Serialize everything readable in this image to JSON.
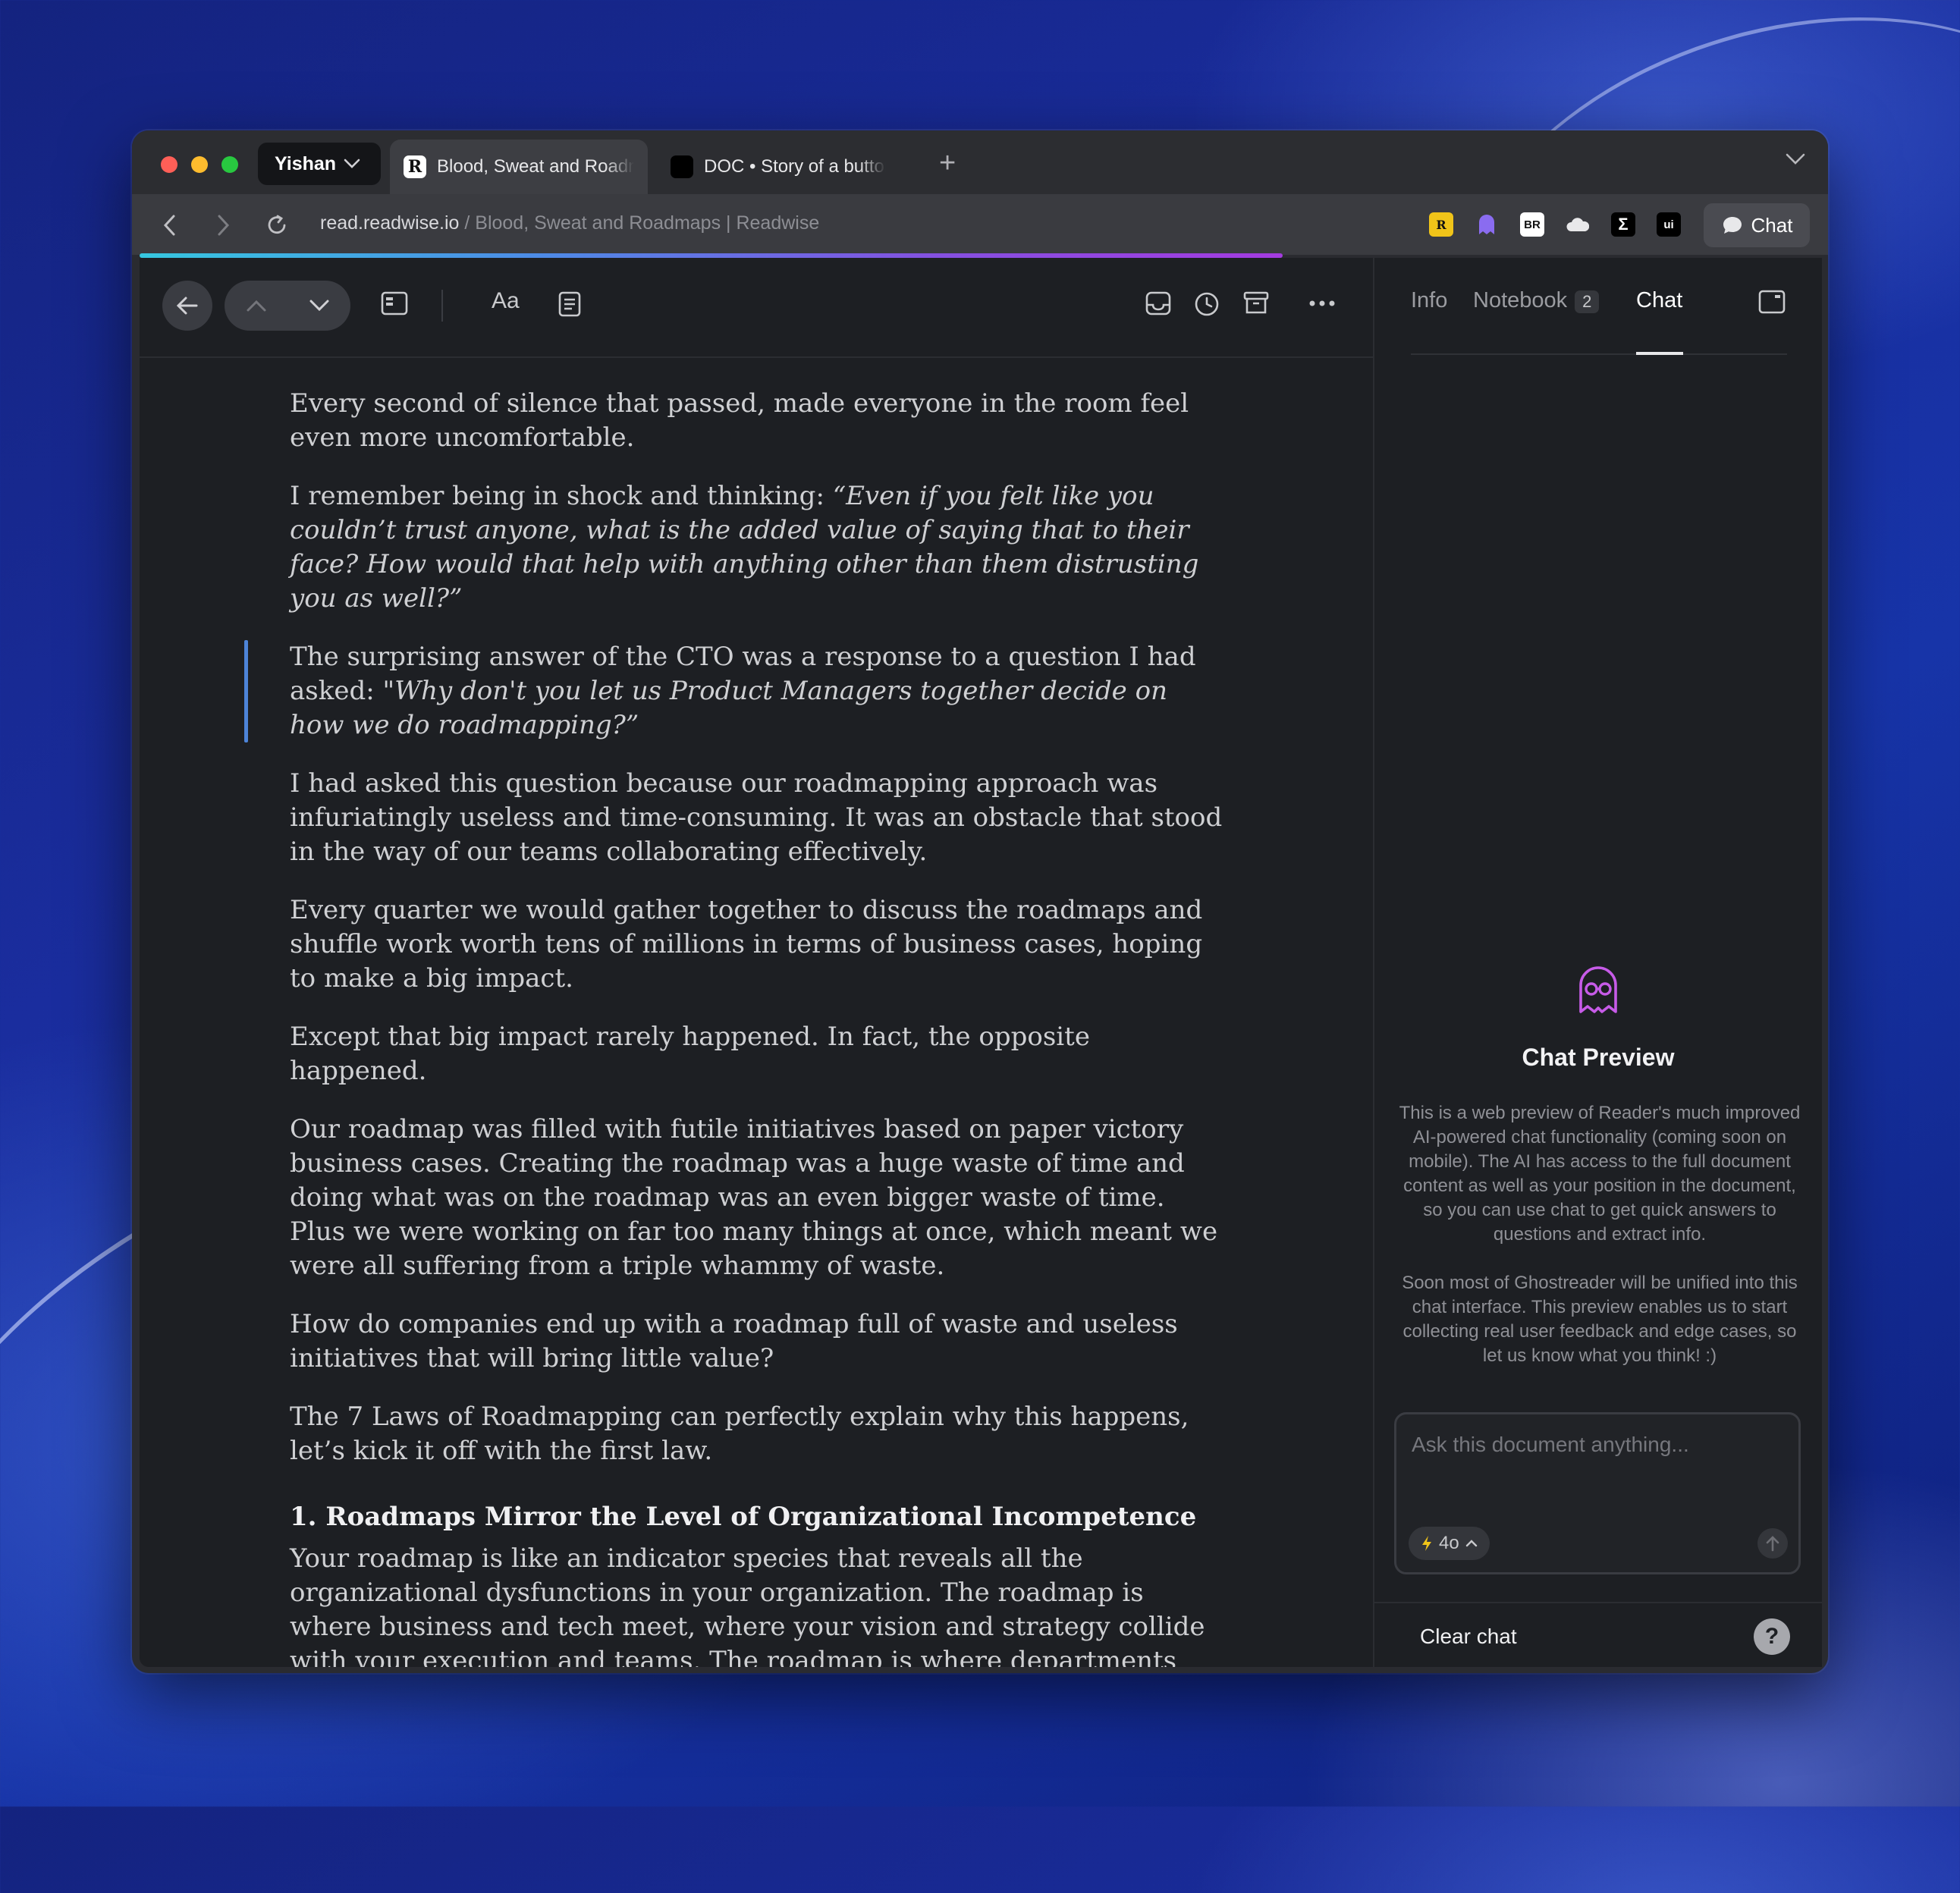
{
  "browser": {
    "profile": "Yishan",
    "tabs": [
      {
        "label": "Blood, Sweat and Roadmaps | Readwise",
        "favicon": "R"
      },
      {
        "label": "DOC • Story of a button"
      }
    ],
    "url_host": "read.readwise.io",
    "url_title": " / Blood, Sweat and Roadmaps | Readwise",
    "chat_button": "Chat",
    "reading_progress": 0.68
  },
  "toolbar": {
    "font_button": "Aa"
  },
  "article": {
    "p1": "Every second of silence that passed, made everyone in the room feel even more uncomfortable.",
    "p2_start": "I remember being in shock and thinking: ",
    "p2_quote": "“Even if you felt like you couldn’t trust anyone, what is the added value of saying that to their face? How would that help with anything other than them distrusting you as well?”",
    "p3_start": "The surprising answer of the CTO was a response to a question I had asked: ",
    "p3_quote": "\"Why don't you let us Product Managers together decide on how we do roadmapping?”",
    "p4": "I had asked this question because our roadmapping approach was infuriatingly useless and time-consuming. It was an obstacle that stood in the way of our teams collaborating effectively.",
    "p5": "Every quarter we would gather together to discuss the roadmaps and shuffle work worth tens of millions in terms of business cases, hoping to make a big impact.",
    "p6": "Except that big impact rarely happened. In fact, the opposite happened.",
    "p7": "Our roadmap was filled with futile initiatives based on paper victory business cases. Creating the roadmap was a huge waste of time and doing what was on the roadmap was an even bigger waste of time. Plus we were working on far too many things at once, which meant we were all suffering from a triple whammy of waste.",
    "p8": "How do companies end up with a roadmap full of waste and useless initiatives that will bring little value?",
    "p9": "The 7 Laws of Roadmapping can perfectly explain why this happens, let’s kick it off with the first law.",
    "h1": "1. Roadmaps Mirror the Level of Organizational Incompetence",
    "p10": "Your roadmap is like an indicator species that reveals all the organizational dysfunctions in your organization. The roadmap is where business and tech meet, where your vision and strategy collide with your execution and teams. The roadmap is where departments and business units compete with your teams and other organizational priorities."
  },
  "side": {
    "tabs": {
      "info": "Info",
      "notebook": "Notebook",
      "notebook_count": "2",
      "chat": "Chat"
    },
    "chat_preview": {
      "title": "Chat Preview",
      "body1": "This is a web preview of Reader's much improved AI-powered chat functionality (coming soon on mobile). The AI has access to the full document content as well as your position in the document, so you can use chat to get quick answers to questions and extract info.",
      "body2": "Soon most of Ghostreader will be unified into this chat interface. This preview enables us to start collecting real user feedback and edge cases, so let us know what you think! :)"
    },
    "input_placeholder": "Ask this document anything...",
    "model": "4o",
    "clear_chat": "Clear chat",
    "help": "?"
  },
  "colors": {
    "accent_purple": "#a43be0",
    "highlight_blue": "#4d84d8",
    "ghost_icon": "#c75be8"
  }
}
